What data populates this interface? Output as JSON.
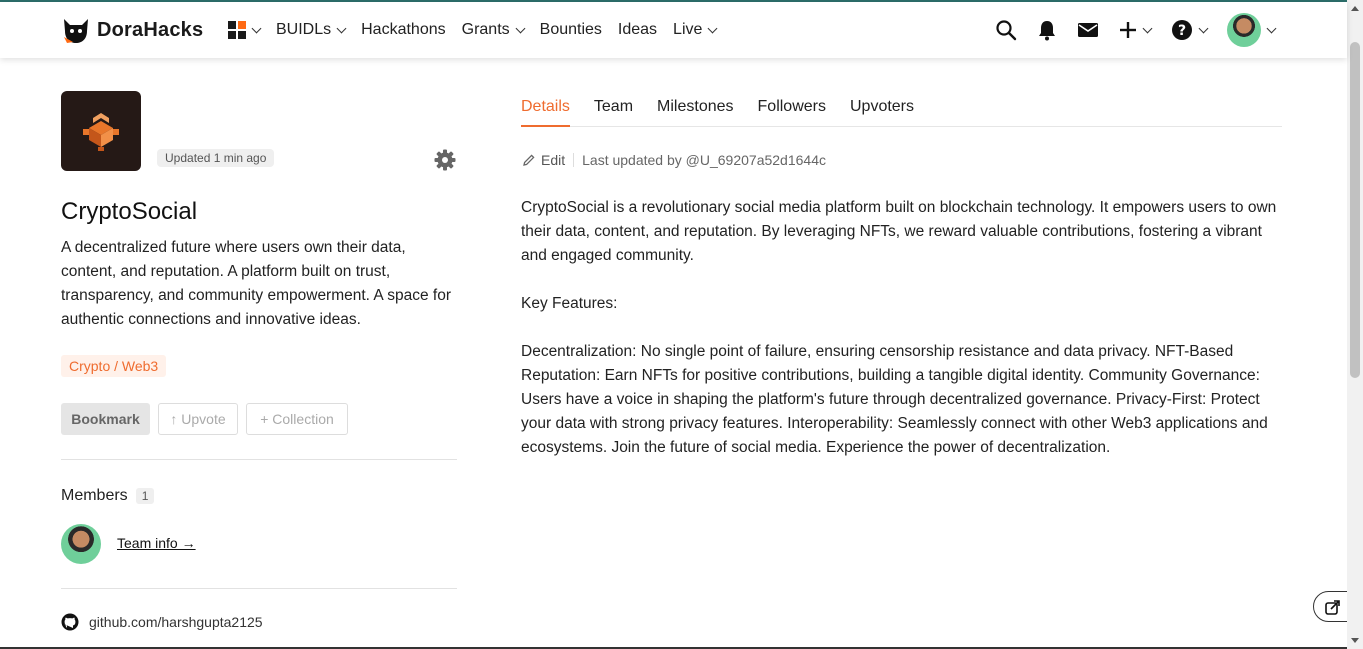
{
  "header": {
    "brand": "DoraHacks",
    "nav": [
      {
        "label": "BUIDLs",
        "dropdown": true
      },
      {
        "label": "Hackathons",
        "dropdown": false
      },
      {
        "label": "Grants",
        "dropdown": true
      },
      {
        "label": "Bounties",
        "dropdown": false
      },
      {
        "label": "Ideas",
        "dropdown": false
      },
      {
        "label": "Live",
        "dropdown": true
      }
    ],
    "icons": [
      "apps-icon",
      "search-icon",
      "bell-icon",
      "mail-icon",
      "plus-icon",
      "help-icon",
      "avatar"
    ],
    "accent": "#ff6a13"
  },
  "project": {
    "updated": "Updated 1 min ago",
    "title": "CryptoSocial",
    "description": "A decentralized future where users own their data, content, and reputation. A platform built on trust, transparency, and community empowerment. A space for authentic connections and innovative ideas.",
    "tag": "Crypto / Web3",
    "buttons": {
      "bookmark": "Bookmark",
      "upvote": "↑ Upvote",
      "collection": "+ Collection"
    },
    "members_title": "Members",
    "members_count": "1",
    "team_info": "Team info →",
    "github": "github.com/harshgupta2125"
  },
  "tabs": [
    "Details",
    "Team",
    "Milestones",
    "Followers",
    "Upvoters"
  ],
  "details": {
    "edit_label": "Edit",
    "last_updated": "Last updated by @U_69207a52d1644c",
    "paragraphs": [
      "CryptoSocial is a revolutionary social media platform built on blockchain technology. It empowers users to own their data, content, and reputation. By leveraging NFTs, we reward valuable contributions, fostering a vibrant and engaged community.",
      "Key Features:",
      "Decentralization: No single point of failure, ensuring censorship resistance and data privacy. NFT-Based Reputation: Earn NFTs for positive contributions, building a tangible digital identity. Community Governance: Users have a voice in shaping the platform's future through decentralized governance. Privacy-First: Protect your data with strong privacy features. Interoperability: Seamlessly connect with other Web3 applications and ecosystems. Join the future of social media. Experience the power of decentralization."
    ]
  },
  "colors": {
    "active_tab": "#ef6c2f",
    "tag_bg": "#fff1ea",
    "top_line": "#2c6e6a"
  }
}
